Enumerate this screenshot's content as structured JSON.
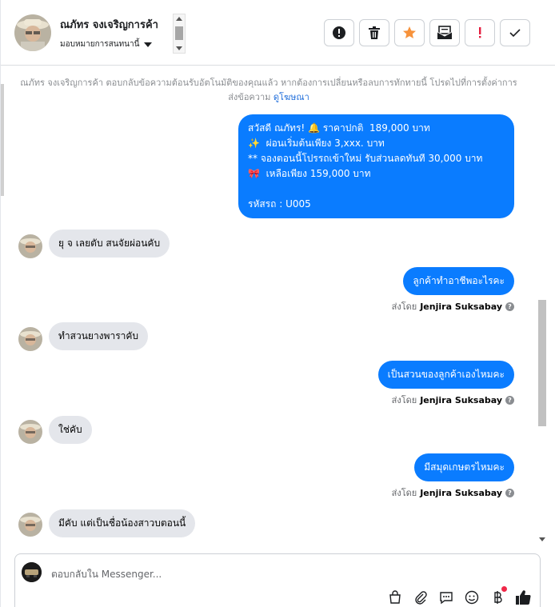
{
  "header": {
    "contact_name": "ณภัทร จงเจริญการค้า",
    "assign_label": "มอบหมายการสนทนานี้",
    "actions": [
      {
        "name": "spam-button",
        "icon": "alert-circle-icon"
      },
      {
        "name": "delete-button",
        "icon": "trash-icon"
      },
      {
        "name": "star-button",
        "icon": "star-icon"
      },
      {
        "name": "mark-unread-button",
        "icon": "envelope-icon"
      },
      {
        "name": "follow-up-button",
        "icon": "exclamation-icon"
      },
      {
        "name": "mark-done-button",
        "icon": "checkmark-icon"
      }
    ]
  },
  "thread": {
    "notice_text": "ณภัทร จงเจริญการค้า ตอบกลับข้อความต้อนรับอัตโนมัติของคุณแล้ว หากต้องการเปลี่ยนหรือลบการทักทายนี้ โปรดไปที่การตั้งค่าการส่งข้อความ",
    "notice_link": "ดูโฆษณา",
    "promo_message": "สวัสดี ณภัทร! 🔔 ราคาปกติ  189,000 บาท\n✨  ผ่อนเริ่มต้นเพียง 3,xxx. บาท\n** จองตอนนี้โปรรถเข้าใหม่ รับส่วนลดทันที 30,000 บาท\n🎀  เหลือเพียง 159,000 บาท\n\nรหัสรถ : U005",
    "messages": [
      {
        "dir": "in",
        "text": "ยุ จ เลยตับ สนจัยผ่อนคับ"
      },
      {
        "dir": "out",
        "text": "ลูกค้าทำอาชีพอะไรคะ",
        "sent_by_prefix": "ส่งโดย",
        "sent_by": "Jenjira Suksabay"
      },
      {
        "dir": "in",
        "text": "ทำสวนยางพาราคับ"
      },
      {
        "dir": "out",
        "text": "เป็นสวนของลูกค้าเองไหมคะ",
        "sent_by_prefix": "ส่งโดย",
        "sent_by": "Jenjira Suksabay"
      },
      {
        "dir": "in",
        "text": "ใช่คับ"
      },
      {
        "dir": "out",
        "text": "มีสมุดเกษตรไหมคะ",
        "sent_by_prefix": "ส่งโดย",
        "sent_by": "Jenjira Suksabay"
      },
      {
        "dir": "in",
        "text": "มีคับ แต่เป็นชื่อน้องสาวบตอนนี้"
      }
    ]
  },
  "composer": {
    "placeholder": "ตอบกลับใน Messenger...",
    "tools": [
      "shop-bag-icon",
      "paperclip-icon",
      "saved-reply-icon",
      "emoji-icon",
      "payment-baht-icon",
      "thumbs-up-icon"
    ]
  },
  "colors": {
    "outgoing_bubble": "#0a7cff",
    "incoming_bubble": "#e4e6eb",
    "star": "#f7923b",
    "follow_up": "#e41e3f"
  }
}
